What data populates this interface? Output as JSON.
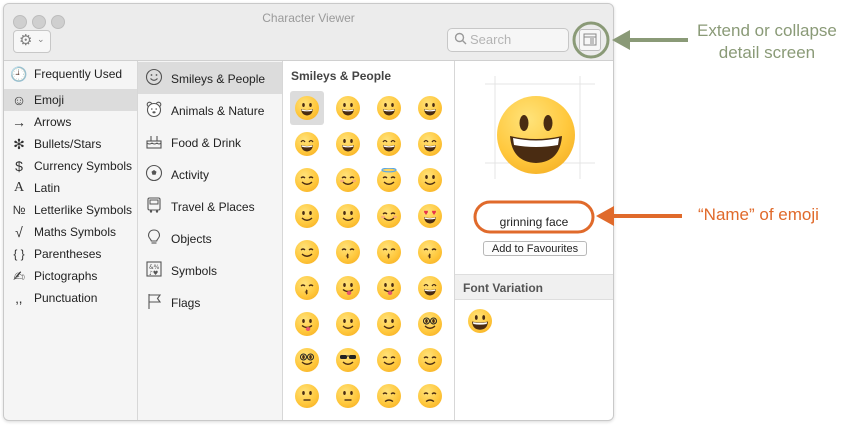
{
  "window": {
    "title": "Character Viewer"
  },
  "toolbar": {
    "gear_icon": "gear-icon",
    "search_placeholder": "Search"
  },
  "categories": [
    {
      "label": "Frequently Used",
      "icon": "🕘"
    },
    {
      "label": "Emoji",
      "icon": "☺"
    },
    {
      "label": "Arrows",
      "icon": "→"
    },
    {
      "label": "Bullets/Stars",
      "icon": "✻"
    },
    {
      "label": "Currency Symbols",
      "icon": "$"
    },
    {
      "label": "Latin",
      "icon": "A"
    },
    {
      "label": "Letterlike Symbols",
      "icon": "№"
    },
    {
      "label": "Maths Symbols",
      "icon": "√"
    },
    {
      "label": "Parentheses",
      "icon": "{ }"
    },
    {
      "label": "Pictographs",
      "icon": "✍"
    },
    {
      "label": "Punctuation",
      "icon": "‚,"
    }
  ],
  "selected_category": "Emoji",
  "groups": [
    {
      "label": "Smileys & People",
      "icon": "smiley-icon"
    },
    {
      "label": "Animals & Nature",
      "icon": "bear-icon"
    },
    {
      "label": "Food & Drink",
      "icon": "cake-icon"
    },
    {
      "label": "Activity",
      "icon": "soccer-ball-icon"
    },
    {
      "label": "Travel & Places",
      "icon": "bus-icon"
    },
    {
      "label": "Objects",
      "icon": "lightbulb-icon"
    },
    {
      "label": "Symbols",
      "icon": "symbols-icon"
    },
    {
      "label": "Flags",
      "icon": "flag-icon"
    }
  ],
  "selected_group": "Smileys & People",
  "grid": {
    "heading": "Smileys & People",
    "rows": 9,
    "columns": 4,
    "faces": [
      "grin",
      "grin",
      "grin",
      "grin",
      "laugh",
      "sweat",
      "tears",
      "rofl",
      "smile",
      "blush",
      "halo",
      "slight",
      "upside",
      "wink",
      "relieved",
      "hearteyes",
      "hearts",
      "kiss",
      "kiss",
      "kiss",
      "kiss",
      "tongue",
      "tongue",
      "squint",
      "zany",
      "raised",
      "monocle",
      "nerd",
      "nerd",
      "sunglasses",
      "star",
      "party",
      "smirk",
      "unamused",
      "disappointed",
      "pensive"
    ]
  },
  "detail": {
    "name": "grinning face",
    "add_button": "Add to Favourites",
    "font_variation_heading": "Font Variation"
  },
  "annotations": {
    "detail_label": "Extend or collapse\ndetail screen",
    "name_label": "“Name” of emoji",
    "colors": {
      "olive": "#8a9a77",
      "orange": "#e06a2b"
    }
  }
}
